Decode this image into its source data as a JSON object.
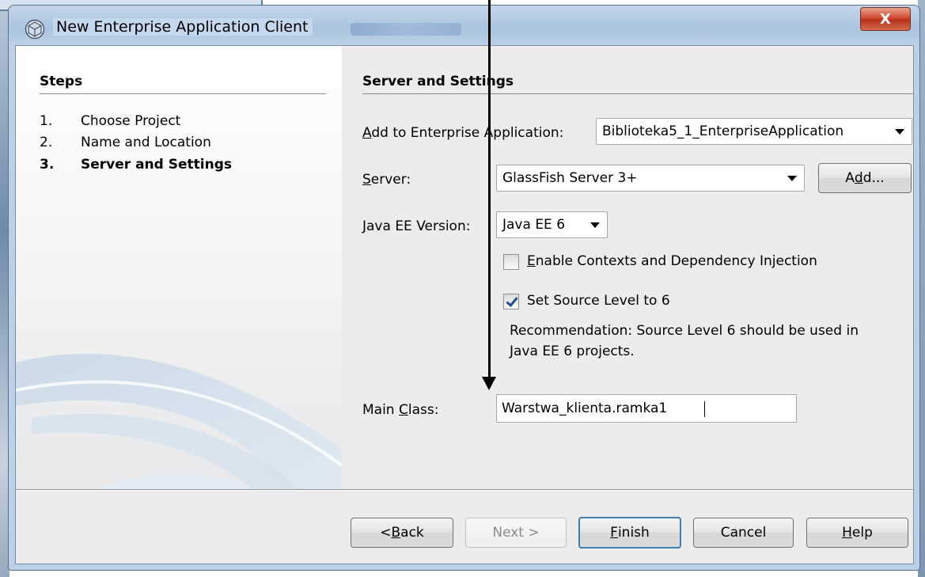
{
  "window": {
    "title": "New Enterprise Application Client",
    "close_label": "X"
  },
  "steps": {
    "header": "Steps",
    "items": [
      {
        "num": "1.",
        "label": "Choose Project",
        "current": false
      },
      {
        "num": "2.",
        "label": "Name and Location",
        "current": false
      },
      {
        "num": "3.",
        "label": "Server and Settings",
        "current": true
      }
    ]
  },
  "content": {
    "header": "Server and Settings",
    "enterprise_app": {
      "label_mnemonic": "A",
      "label_rest": "dd to Enterprise Application:",
      "value": "Biblioteka5_1_EnterpriseApplication"
    },
    "server": {
      "label_mnemonic": "S",
      "label_rest": "erver:",
      "value": "GlassFish Server 3+",
      "add_pre": "A",
      "add_mnemonic": "d",
      "add_post": "d..."
    },
    "java_ee": {
      "label_mnemonic": "J",
      "label_rest": "ava EE Version:",
      "value": "Java EE 6"
    },
    "cdi_checkbox": {
      "mnemonic": "E",
      "rest": "nable Contexts and Dependency Injection",
      "checked": false
    },
    "source_level_checkbox": {
      "label": "Set Source Level to 6",
      "checked": true
    },
    "recommendation_line1": "Recommendation: Source Level 6 should be used in",
    "recommendation_line2": "Java EE 6 projects.",
    "main_class": {
      "label_pre": "Main ",
      "label_mnemonic": "C",
      "label_post": "lass:",
      "value": "Warstwa_klienta.ramka1"
    }
  },
  "buttons": {
    "back_pre": "< ",
    "back_mnemonic": "B",
    "back_post": "ack",
    "next": "Next >",
    "finish_mnemonic": "F",
    "finish_post": "inish",
    "cancel": "Cancel",
    "help_mnemonic": "H",
    "help_post": "elp"
  },
  "colors": {
    "close_button": "#cf4a2f",
    "default_button_border": "#3c7fb1",
    "panel_bg": "#ececec"
  }
}
